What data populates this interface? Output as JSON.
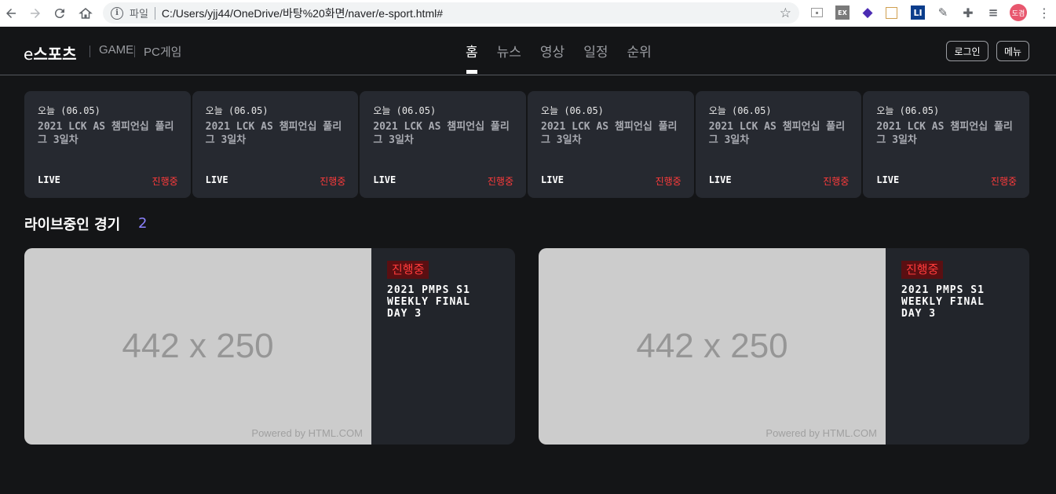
{
  "browser": {
    "protocol": "파일",
    "url": "C:/Users/yjj44/OneDrive/바탕%20화면/naver/e-sport.html#",
    "avatar_text": "도겸"
  },
  "site": {
    "logo_prefix": "e",
    "logo_main": "스포츠",
    "crumbs": [
      "GAME",
      "PC게임"
    ],
    "nav": [
      "홈",
      "뉴스",
      "영상",
      "일정",
      "순위"
    ],
    "login_label": "로그인",
    "menu_label": "메뉴"
  },
  "schedule": [
    {
      "date": "오늘 (06.05)",
      "title": "2021 LCK AS 챔피언십 풀리그 3일차",
      "live": "LIVE",
      "status": "진행중"
    },
    {
      "date": "오늘 (06.05)",
      "title": "2021 LCK AS 챔피언십 풀리그 3일차",
      "live": "LIVE",
      "status": "진행중"
    },
    {
      "date": "오늘 (06.05)",
      "title": "2021 LCK AS 챔피언십 풀리그 3일차",
      "live": "LIVE",
      "status": "진행중"
    },
    {
      "date": "오늘 (06.05)",
      "title": "2021 LCK AS 챔피언십 풀리그 3일차",
      "live": "LIVE",
      "status": "진행중"
    },
    {
      "date": "오늘 (06.05)",
      "title": "2021 LCK AS 챔피언십 풀리그 3일차",
      "live": "LIVE",
      "status": "진행중"
    },
    {
      "date": "오늘 (06.05)",
      "title": "2021 LCK AS 챔피언십 풀리그 3일차",
      "live": "LIVE",
      "status": "진행중"
    }
  ],
  "live_section": {
    "title": "라이브중인 경기",
    "count": "2",
    "matches": [
      {
        "thumb_text": "442 x 250",
        "powered": "Powered by HTML.COM",
        "badge": "진행중",
        "title": "2021 PMPS S1\nWEEKLY FINAL\nDAY 3"
      },
      {
        "thumb_text": "442 x 250",
        "powered": "Powered by HTML.COM",
        "badge": "진행중",
        "title": "2021 PMPS S1\nWEEKLY FINAL\nDAY 3"
      }
    ]
  },
  "colors": {
    "background": "#141517",
    "card": "#262930",
    "live_red": "#ff3b3b",
    "count_purple": "#8c82ff"
  }
}
